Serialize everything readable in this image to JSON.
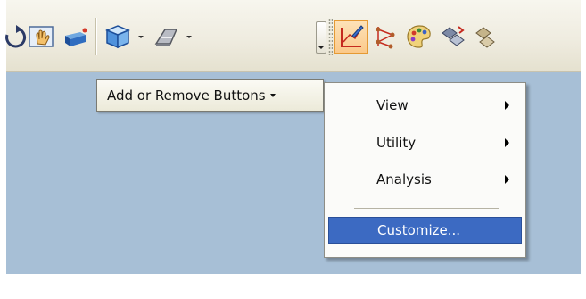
{
  "toolbar": {
    "icons": [
      "rotate-icon",
      "pan-icon",
      "shaded-box-icon",
      "cube-icon",
      "render-icon",
      "sketch-icon",
      "vertex-icon",
      "palette-icon",
      "transform-icon"
    ]
  },
  "add_remove": {
    "label": "Add or Remove Buttons"
  },
  "menu": {
    "items": [
      {
        "label": "View",
        "submenu": true
      },
      {
        "label": "Utility",
        "submenu": true
      },
      {
        "label": "Analysis",
        "submenu": true
      }
    ],
    "customize_label": "Customize..."
  },
  "colors": {
    "canvas": "#a7bfd6",
    "selection": "#3c6ac2",
    "active_tool": "#fbc98a"
  }
}
